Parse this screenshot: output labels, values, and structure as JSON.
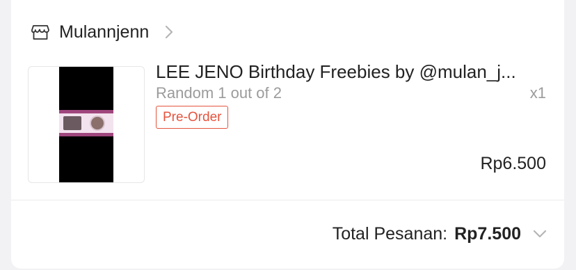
{
  "shop": {
    "name": "Mulannjenn",
    "icon": "store-icon"
  },
  "product": {
    "title": "LEE JENO Birthday Freebies by @mulan_j...",
    "variant": "Random 1 out of 2",
    "quantity": "x1",
    "badge": "Pre-Order",
    "price": "Rp6.500"
  },
  "order": {
    "total_label": "Total Pesanan:",
    "total_value": "Rp7.500"
  },
  "colors": {
    "badge": "#e5533d",
    "text": "#222222",
    "muted": "#9b9b9b"
  }
}
